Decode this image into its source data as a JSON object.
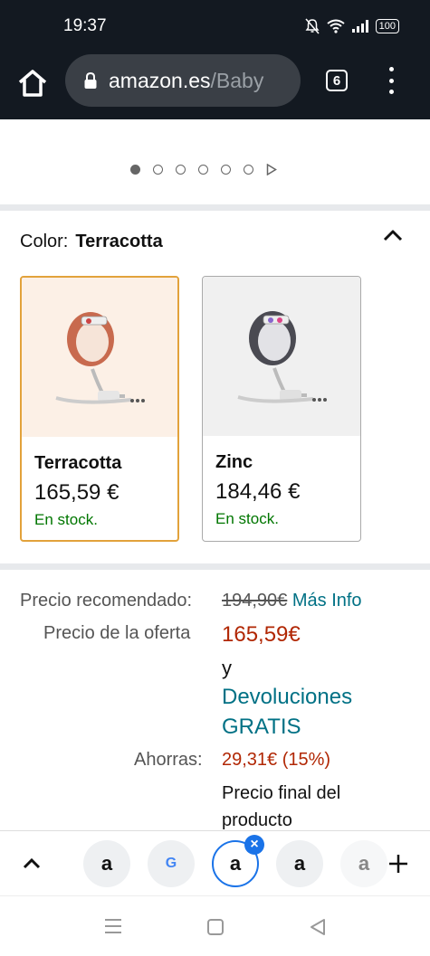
{
  "status": {
    "time": "19:37",
    "battery": "100"
  },
  "browser": {
    "url_main": "amazon.es",
    "url_rest": "/Baby",
    "tab_count": "6"
  },
  "carousel": {
    "count": 6,
    "active": 0
  },
  "color": {
    "label": "Color:",
    "selected": "Terracotta"
  },
  "variants": [
    {
      "name": "Terracotta",
      "price": "165,59 €",
      "stock": "En stock.",
      "accent": "#c86a4e",
      "selected": true
    },
    {
      "name": "Zinc",
      "price": "184,46 €",
      "stock": "En stock.",
      "accent": "#4a4a52",
      "selected": false
    }
  ],
  "pricing": {
    "rrp_label": "Precio recomendado:",
    "rrp_value": "194,90€",
    "more_info": "Más Info",
    "offer_label": "Precio de la oferta",
    "offer_value": "165,59€",
    "and_text": "y",
    "returns_line1": "Devoluciones",
    "returns_line2": "GRATIS",
    "save_label": "Ahorras:",
    "save_value": "29,31€ (15%)",
    "final_line1": "Precio final del",
    "final_line2": "producto"
  },
  "tab_strip": [
    {
      "letter": "a",
      "icon": "amazon-icon"
    },
    {
      "letter": "G",
      "icon": "google-icon"
    },
    {
      "letter": "a",
      "icon": "amazon-icon",
      "active": true
    },
    {
      "letter": "a",
      "icon": "amazon-icon"
    },
    {
      "letter": "a",
      "icon": "amazon-icon"
    }
  ]
}
